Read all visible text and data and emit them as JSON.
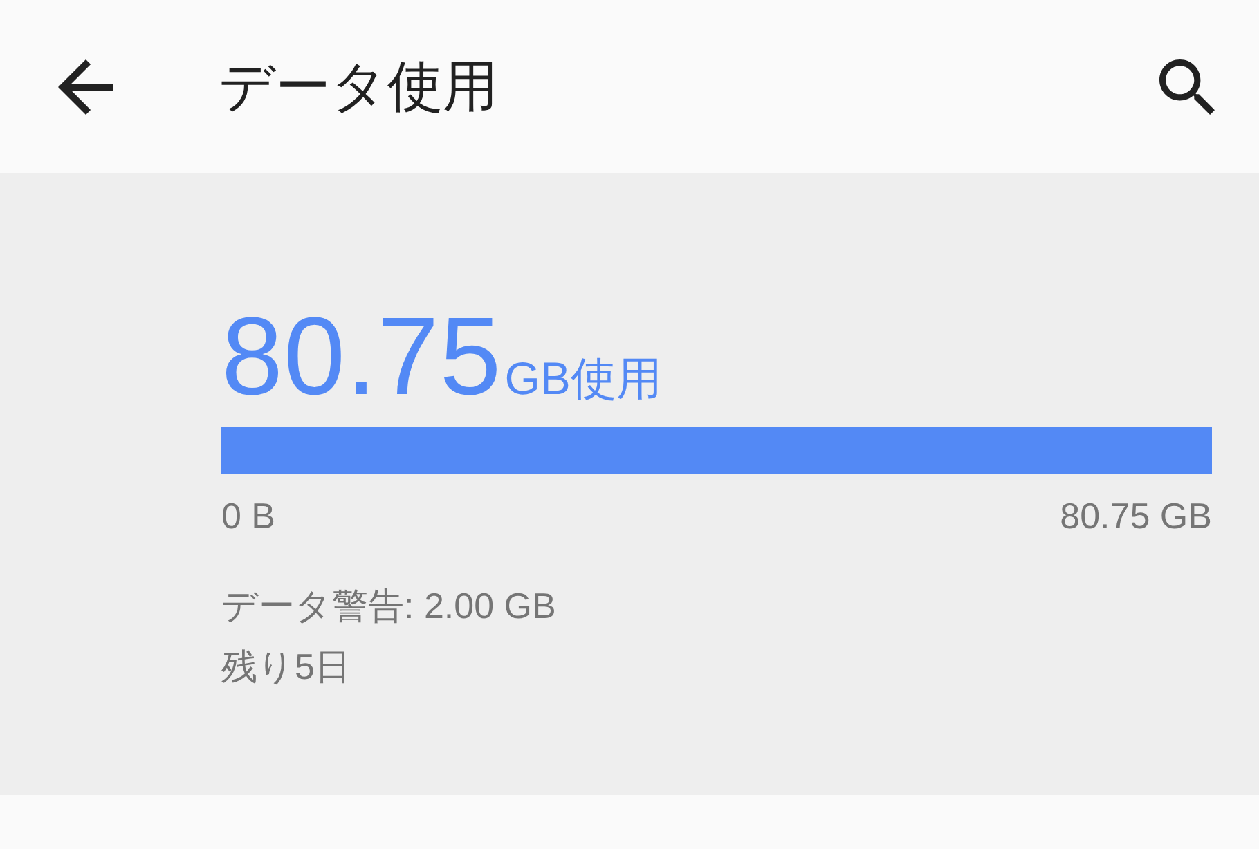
{
  "toolbar": {
    "title": "データ使用"
  },
  "usage": {
    "amount": "80.75",
    "unit": "GB使用",
    "level": 1,
    "min_label": "0 B",
    "max_label": "80.75 GB"
  },
  "warning": "データ警告: 2.00 GB",
  "remaining": "残り5日"
}
